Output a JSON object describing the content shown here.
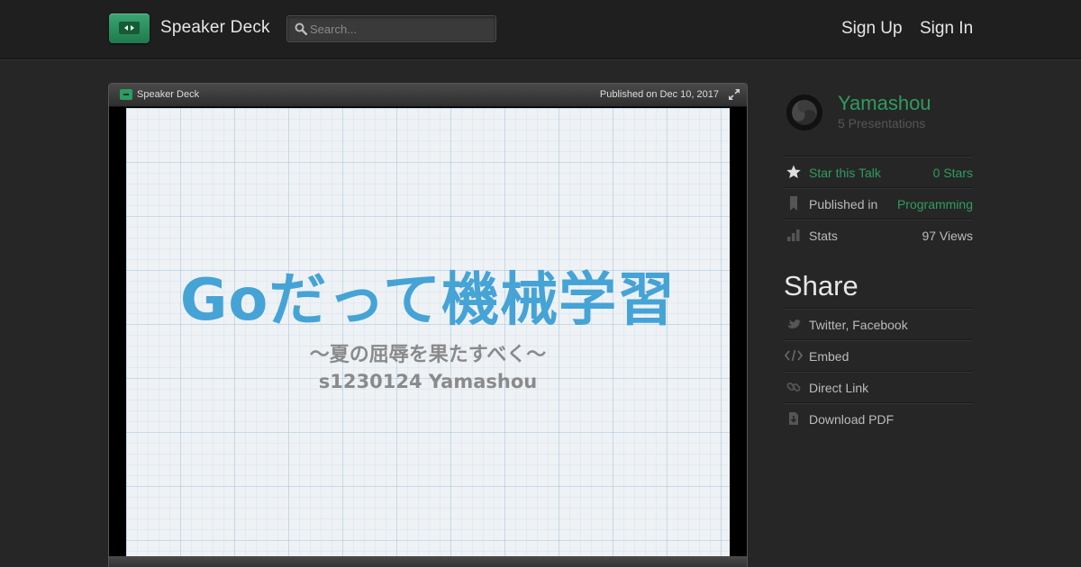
{
  "header": {
    "brand": "Speaker Deck",
    "search_placeholder": "Search...",
    "sign_up": "Sign Up",
    "sign_in": "Sign In"
  },
  "player": {
    "brand": "Speaker Deck",
    "published": "Published on Dec 10, 2017",
    "slide": {
      "title": "Goだって機械学習",
      "subtitle": "〜夏の屈辱を果たすべく〜",
      "author_line": "s1230124 Yamashou"
    }
  },
  "author": {
    "name": "Yamashou",
    "presentations": "5 Presentations"
  },
  "meta": {
    "star_label": "Star this Talk",
    "star_count": "0 Stars",
    "published_label": "Published in",
    "published_value": "Programming",
    "stats_label": "Stats",
    "stats_value": "97 Views"
  },
  "share": {
    "title": "Share",
    "items": [
      "Twitter, Facebook",
      "Embed",
      "Direct Link",
      "Download PDF"
    ]
  },
  "colors": {
    "accent_green": "#2f9c5f",
    "slide_title_blue": "#45a3d6",
    "background": "#262626"
  },
  "icons": [
    "logo-icon",
    "search-icon",
    "expand-icon",
    "avatar",
    "star-icon",
    "bookmark-icon",
    "bar-chart-icon",
    "bird-icon",
    "code-icon",
    "link-icon",
    "download-icon"
  ]
}
